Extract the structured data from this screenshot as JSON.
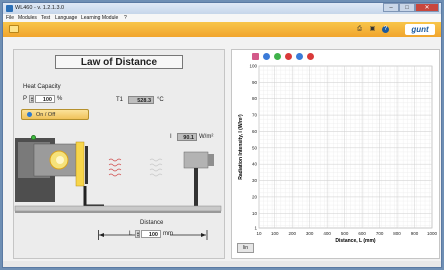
{
  "window": {
    "title": "WL460 - v. 1.2.1.3.0",
    "btn_min": "–",
    "btn_max": "□",
    "btn_close": "✕"
  },
  "menu": [
    "File",
    "Modules",
    "Test",
    "Language",
    "Learning Module",
    "?"
  ],
  "toolbar": {
    "icons": [
      "print-icon",
      "save-icon",
      "help-icon"
    ],
    "print_glyph": "⎙",
    "save_glyph": "▣",
    "help_glyph": "?",
    "logo": "gunt"
  },
  "experiment": {
    "title": "Law of Distance",
    "heat_capacity_label": "Heat Capacity",
    "p_label": "P",
    "p_value": "100",
    "p_unit": "%",
    "onoff_label": "On / Off",
    "t1_label": "T1",
    "t1_value": "528.3",
    "t1_unit": "°C",
    "i_label": "I",
    "i_value": "90.1",
    "i_unit": "W/m²",
    "distance_label": "Distance",
    "l_label": "L",
    "l_value": "100",
    "l_unit": "mm"
  },
  "chart_data": {
    "type": "line",
    "title": "",
    "xlabel": "Distance, L (mm)",
    "ylabel": "Radiation Intensity, I (W/m²)",
    "xlim": [
      10,
      1000
    ],
    "ylim": [
      1,
      100
    ],
    "xticks": [
      10,
      100,
      200,
      300,
      400,
      500,
      600,
      700,
      800,
      900,
      1000
    ],
    "yticks": [
      1,
      10,
      20,
      30,
      40,
      50,
      60,
      70,
      80,
      90,
      100
    ],
    "grid": true,
    "series": []
  },
  "graph": {
    "toolbar_colors": [
      "#d35a8a",
      "#3b7bd8",
      "#3fb24a",
      "#d93a3a",
      "#3b7bd8",
      "#d93a3a"
    ],
    "scale_button": "lin"
  }
}
